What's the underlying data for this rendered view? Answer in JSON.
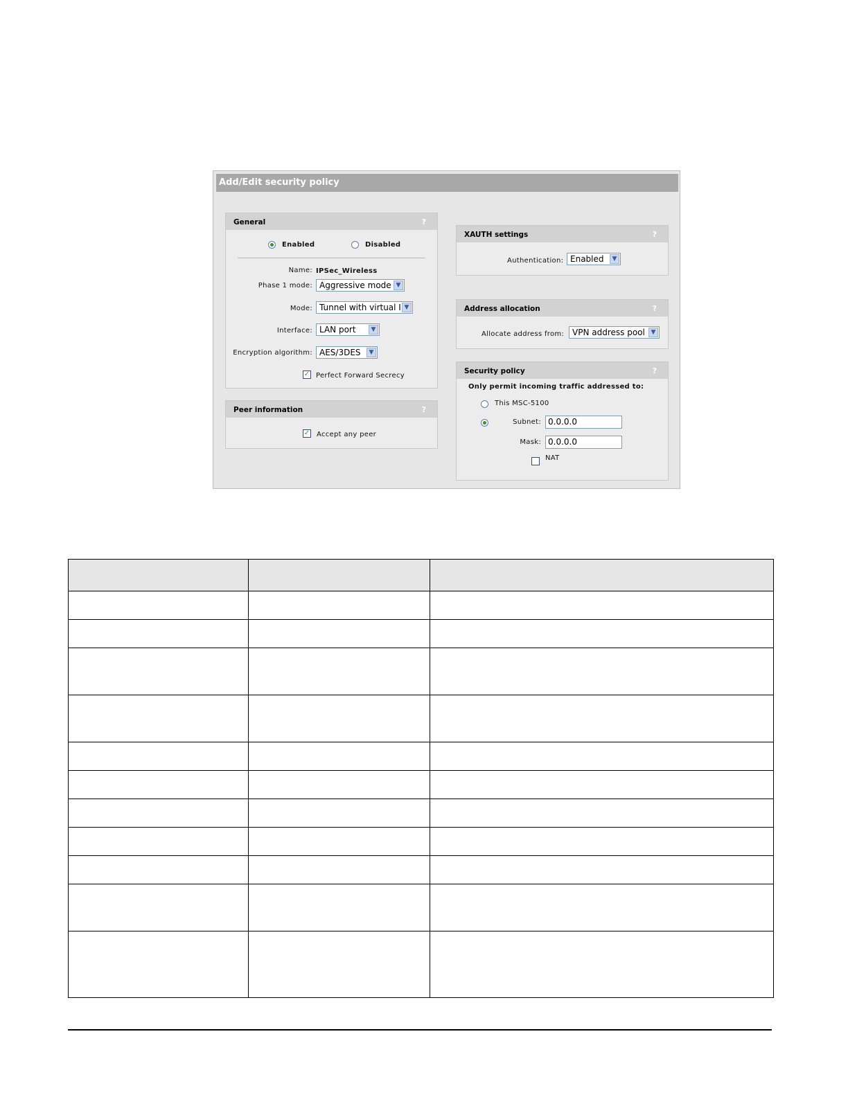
{
  "window": {
    "title": "Add/Edit security policy",
    "help_icon": "?"
  },
  "general": {
    "title": "General",
    "status": {
      "enabled_label": "Enabled",
      "disabled_label": "Disabled",
      "selected": "Enabled"
    },
    "name_label": "Name:",
    "name_value": "IPSec_Wireless",
    "phase1_label": "Phase 1 mode:",
    "phase1_value": "Aggressive mode",
    "mode_label": "Mode:",
    "mode_value": "Tunnel with virtual IP",
    "interface_label": "Interface:",
    "interface_value": "LAN port",
    "encryption_label": "Encryption algorithm:",
    "encryption_value": "AES/3DES",
    "pfs_label": "Perfect Forward Secrecy",
    "pfs_checked": true
  },
  "peer": {
    "title": "Peer information",
    "accept_label": "Accept any peer",
    "accept_checked": true
  },
  "xauth": {
    "title": "XAUTH settings",
    "auth_label": "Authentication:",
    "auth_value": "Enabled"
  },
  "address": {
    "title": "Address allocation",
    "allocate_label": "Allocate address from:",
    "allocate_value": "VPN address pool"
  },
  "security": {
    "title": "Security policy",
    "heading": "Only permit incoming traffic addressed to:",
    "this_label": "This MSC-5100",
    "subnet_label": "Subnet:",
    "subnet_value": "0.0.0.0",
    "mask_label": "Mask:",
    "mask_value": "0.0.0.0",
    "nat_label": "NAT",
    "nat_checked": false,
    "selected": "Subnet"
  },
  "table": {
    "row_count": 11
  }
}
